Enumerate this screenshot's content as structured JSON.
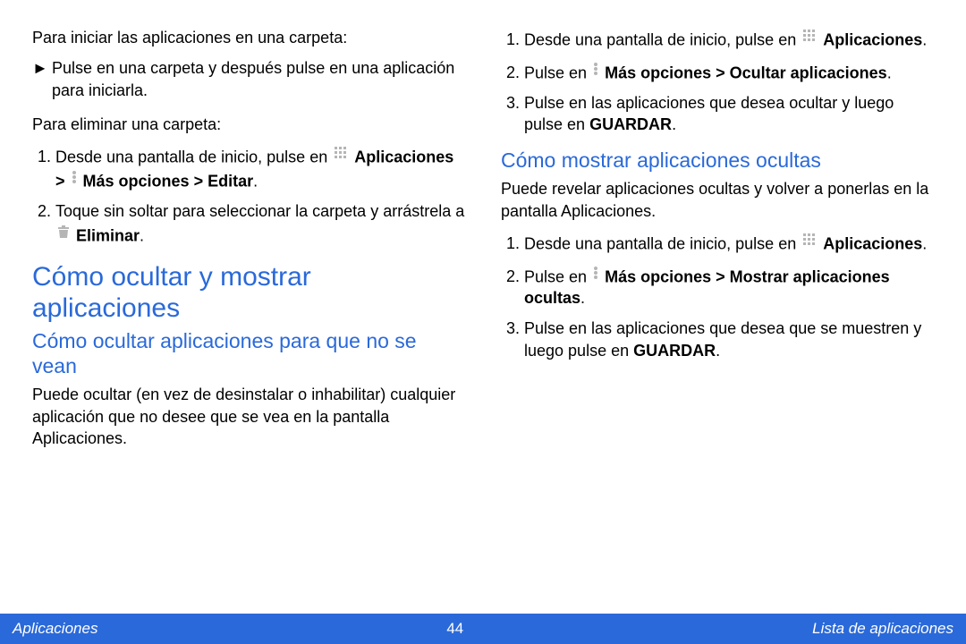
{
  "left": {
    "intro1": "Para iniciar las aplicaciones en una carpeta:",
    "bullet1": "Pulse en una carpeta y después pulse en una aplicación para iniciarla.",
    "intro2": "Para eliminar una carpeta:",
    "ol1": {
      "i1_pre": "Desde una pantalla de inicio, pulse en ",
      "i1_b1": "Aplicaciones",
      "i1_mid": " > ",
      "i1_b2": "Más opciones > Editar",
      "i1_end": ".",
      "i2_pre": "Toque sin soltar para seleccionar la carpeta y arrástrela a ",
      "i2_b": "Eliminar",
      "i2_end": "."
    },
    "h1": "Cómo ocultar y mostrar aplicaciones",
    "h2": "Cómo ocultar aplicaciones para que no se vean",
    "p1": "Puede ocultar (en vez de desinstalar o inhabilitar) cualquier aplicación que no desee que se vea en la pantalla Aplicaciones."
  },
  "right": {
    "ol1": {
      "i1_pre": "Desde una pantalla de inicio, pulse en ",
      "i1_b": "Aplicaciones",
      "i1_end": ".",
      "i2_pre": "Pulse en ",
      "i2_b": "Más opciones > Ocultar aplicaciones",
      "i2_end": ".",
      "i3_pre": "Pulse en las aplicaciones que desea ocultar y luego pulse en ",
      "i3_b": "GUARDAR",
      "i3_end": "."
    },
    "h2": "Cómo mostrar aplicaciones ocultas",
    "p1": "Puede revelar aplicaciones ocultas y volver a ponerlas en la pantalla Aplicaciones.",
    "ol2": {
      "i1_pre": "Desde una pantalla de inicio, pulse en ",
      "i1_b": "Aplicaciones",
      "i1_end": ".",
      "i2_pre": "Pulse en ",
      "i2_b": "Más opciones > Mostrar aplicaciones ocultas",
      "i2_end": ".",
      "i3_pre": "Pulse en las aplicaciones que desea que se muestren y luego pulse en ",
      "i3_b": "GUARDAR",
      "i3_end": "."
    }
  },
  "footer": {
    "left": "Aplicaciones",
    "center": "44",
    "right": "Lista de aplicaciones"
  },
  "glyphs": {
    "arrow": "►"
  }
}
